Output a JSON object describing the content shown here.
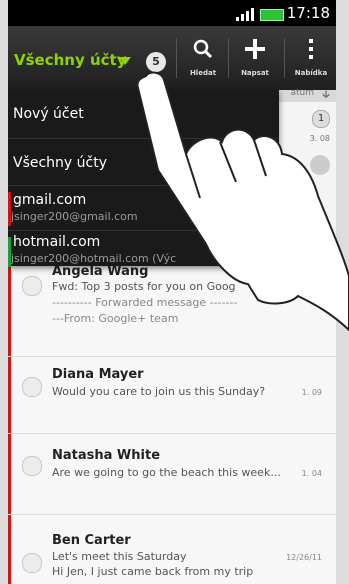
{
  "status": {
    "time": "17:18"
  },
  "actionbar": {
    "account_title": "Všechny účty",
    "unread_count": "5",
    "search_label": "Hledat",
    "compose_label": "Napsat",
    "menu_label": "Nabídka"
  },
  "list_header": {
    "sort_label": "atum"
  },
  "side": {
    "count": "1",
    "date": "3. 08"
  },
  "dropdown": {
    "new_account": "Nový účet",
    "all_accounts": "Všechny účty",
    "accounts": [
      {
        "name": "gmail.com",
        "email": "jsinger200@gmail.com",
        "color": "#d41414"
      },
      {
        "name": "hotmail.com",
        "email": "jsinger200@hotmail.com (Výc",
        "color": "#19a03a"
      }
    ]
  },
  "messages": [
    {
      "sender": "Angela Wang",
      "line1": "Fwd: Top 3 posts for you on Goog",
      "line2": "---------- Forwarded message -------",
      "line3": "---From: Google+ team",
      "date": "3"
    },
    {
      "sender": "Diana Mayer",
      "line1": "Would you care to join us this Sunday?",
      "date": "1. 09"
    },
    {
      "sender": "Natasha White",
      "line1": "Are we going to go the beach this week...",
      "date": "1. 04"
    },
    {
      "sender": "Ben Carter",
      "line1": "Let's meet this Saturday",
      "line2": "Hi Jen, I just came back from my trip",
      "date": "12/26/11"
    }
  ]
}
